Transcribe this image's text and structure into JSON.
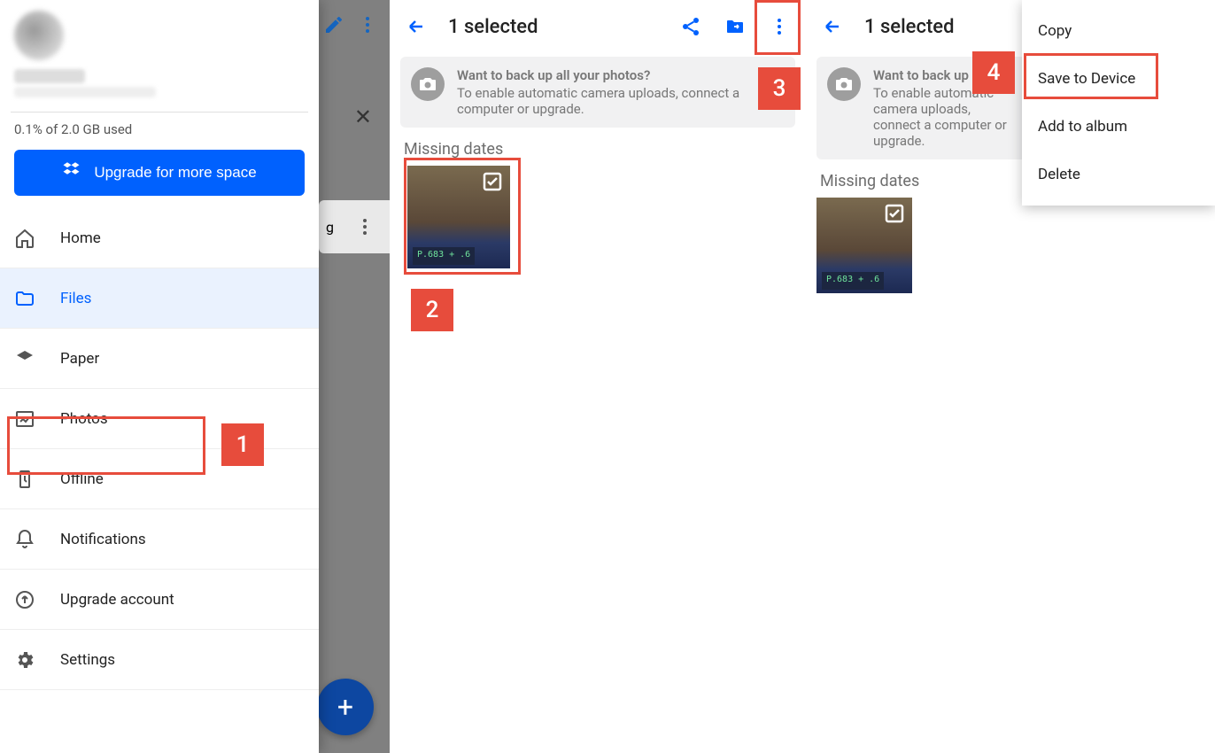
{
  "drawer": {
    "storage_text": "0.1% of 2.0 GB used",
    "upgrade_button": "Upgrade for more space",
    "items": [
      {
        "label": "Home",
        "icon": "home"
      },
      {
        "label": "Files",
        "icon": "folder"
      },
      {
        "label": "Paper",
        "icon": "layers"
      },
      {
        "label": "Photos",
        "icon": "image"
      },
      {
        "label": "Offline",
        "icon": "offline"
      },
      {
        "label": "Notifications",
        "icon": "bell"
      },
      {
        "label": "Upgrade account",
        "icon": "upgrade"
      },
      {
        "label": "Settings",
        "icon": "gear"
      }
    ]
  },
  "panel_header": {
    "selected_text": "1 selected"
  },
  "promo": {
    "title": "Want to back up all your photos?",
    "subtitle_p2": "To enable automatic camera uploads, connect a computer or upgrade.",
    "subtitle_p3": "To enable automatic camera uploads, connect a computer or upgrade."
  },
  "section": {
    "missing_dates": "Missing dates"
  },
  "thumb": {
    "label": "P.683  + .6"
  },
  "menu": {
    "copy": "Copy",
    "save": "Save to Device",
    "add": "Add to album",
    "delete": "Delete"
  },
  "callouts": {
    "c1": "1",
    "c2": "2",
    "c3": "3",
    "c4": "4"
  },
  "partial_text_bg": {
    "row": "g"
  }
}
